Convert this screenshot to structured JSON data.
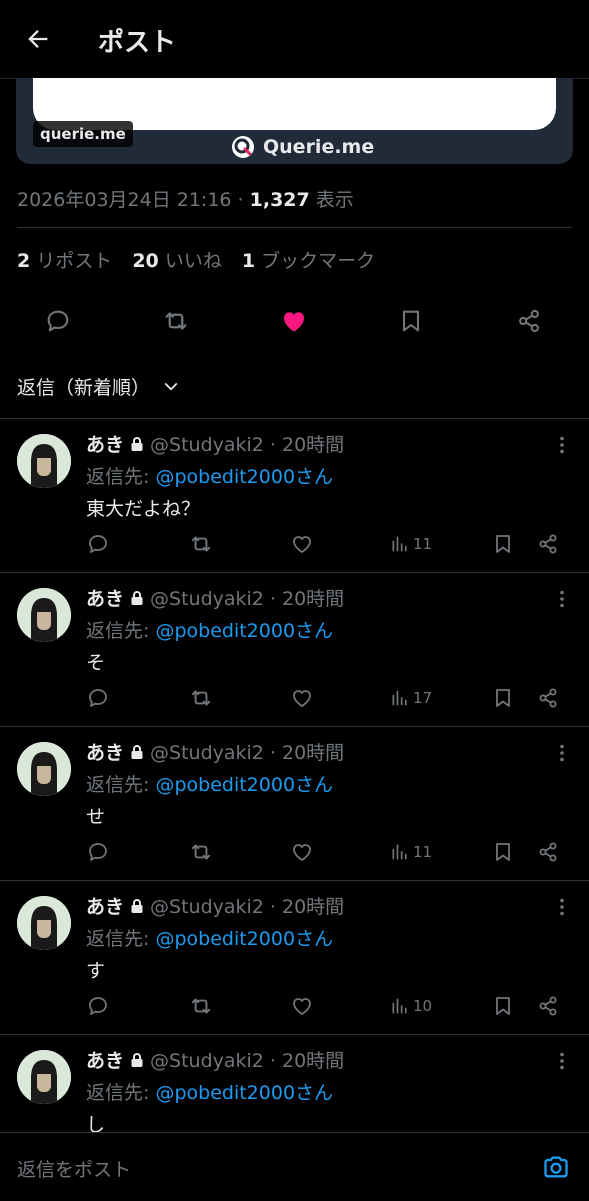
{
  "header": {
    "title": "ポスト"
  },
  "card": {
    "domain": "querie.me",
    "brand": "Querie.me"
  },
  "post_meta": {
    "datetime": "2026年03月24日 21:16 · ",
    "views_count": "1,327",
    "views_label": " 表示"
  },
  "stats": {
    "reposts_count": "2",
    "reposts_label": " リポスト",
    "likes_count": "20",
    "likes_label": " いいね",
    "bookmarks_count": "1",
    "bookmarks_label": " ブックマーク"
  },
  "sort": {
    "label": "返信（新着順）"
  },
  "replies": [
    {
      "name": "あき",
      "handle": "@Studyaki2 · 20時間",
      "replyto_prefix": "返信先: ",
      "replyto_link": "@pobedit2000さん",
      "text": "東大だよね？",
      "views": "11"
    },
    {
      "name": "あき",
      "handle": "@Studyaki2 · 20時間",
      "replyto_prefix": "返信先: ",
      "replyto_link": "@pobedit2000さん",
      "text": "そ",
      "views": "17"
    },
    {
      "name": "あき",
      "handle": "@Studyaki2 · 20時間",
      "replyto_prefix": "返信先: ",
      "replyto_link": "@pobedit2000さん",
      "text": "せ",
      "views": "11"
    },
    {
      "name": "あき",
      "handle": "@Studyaki2 · 20時間",
      "replyto_prefix": "返信先: ",
      "replyto_link": "@pobedit2000さん",
      "text": "す",
      "views": "10"
    },
    {
      "name": "あき",
      "handle": "@Studyaki2 · 20時間",
      "replyto_prefix": "返信先: ",
      "replyto_link": "@pobedit2000さん",
      "text": "し",
      "views": ""
    }
  ],
  "composer": {
    "placeholder": "返信をポスト"
  },
  "colors": {
    "background": "#000000",
    "accent": "#1d9bf0",
    "like": "#f91880",
    "muted": "#71767b"
  }
}
